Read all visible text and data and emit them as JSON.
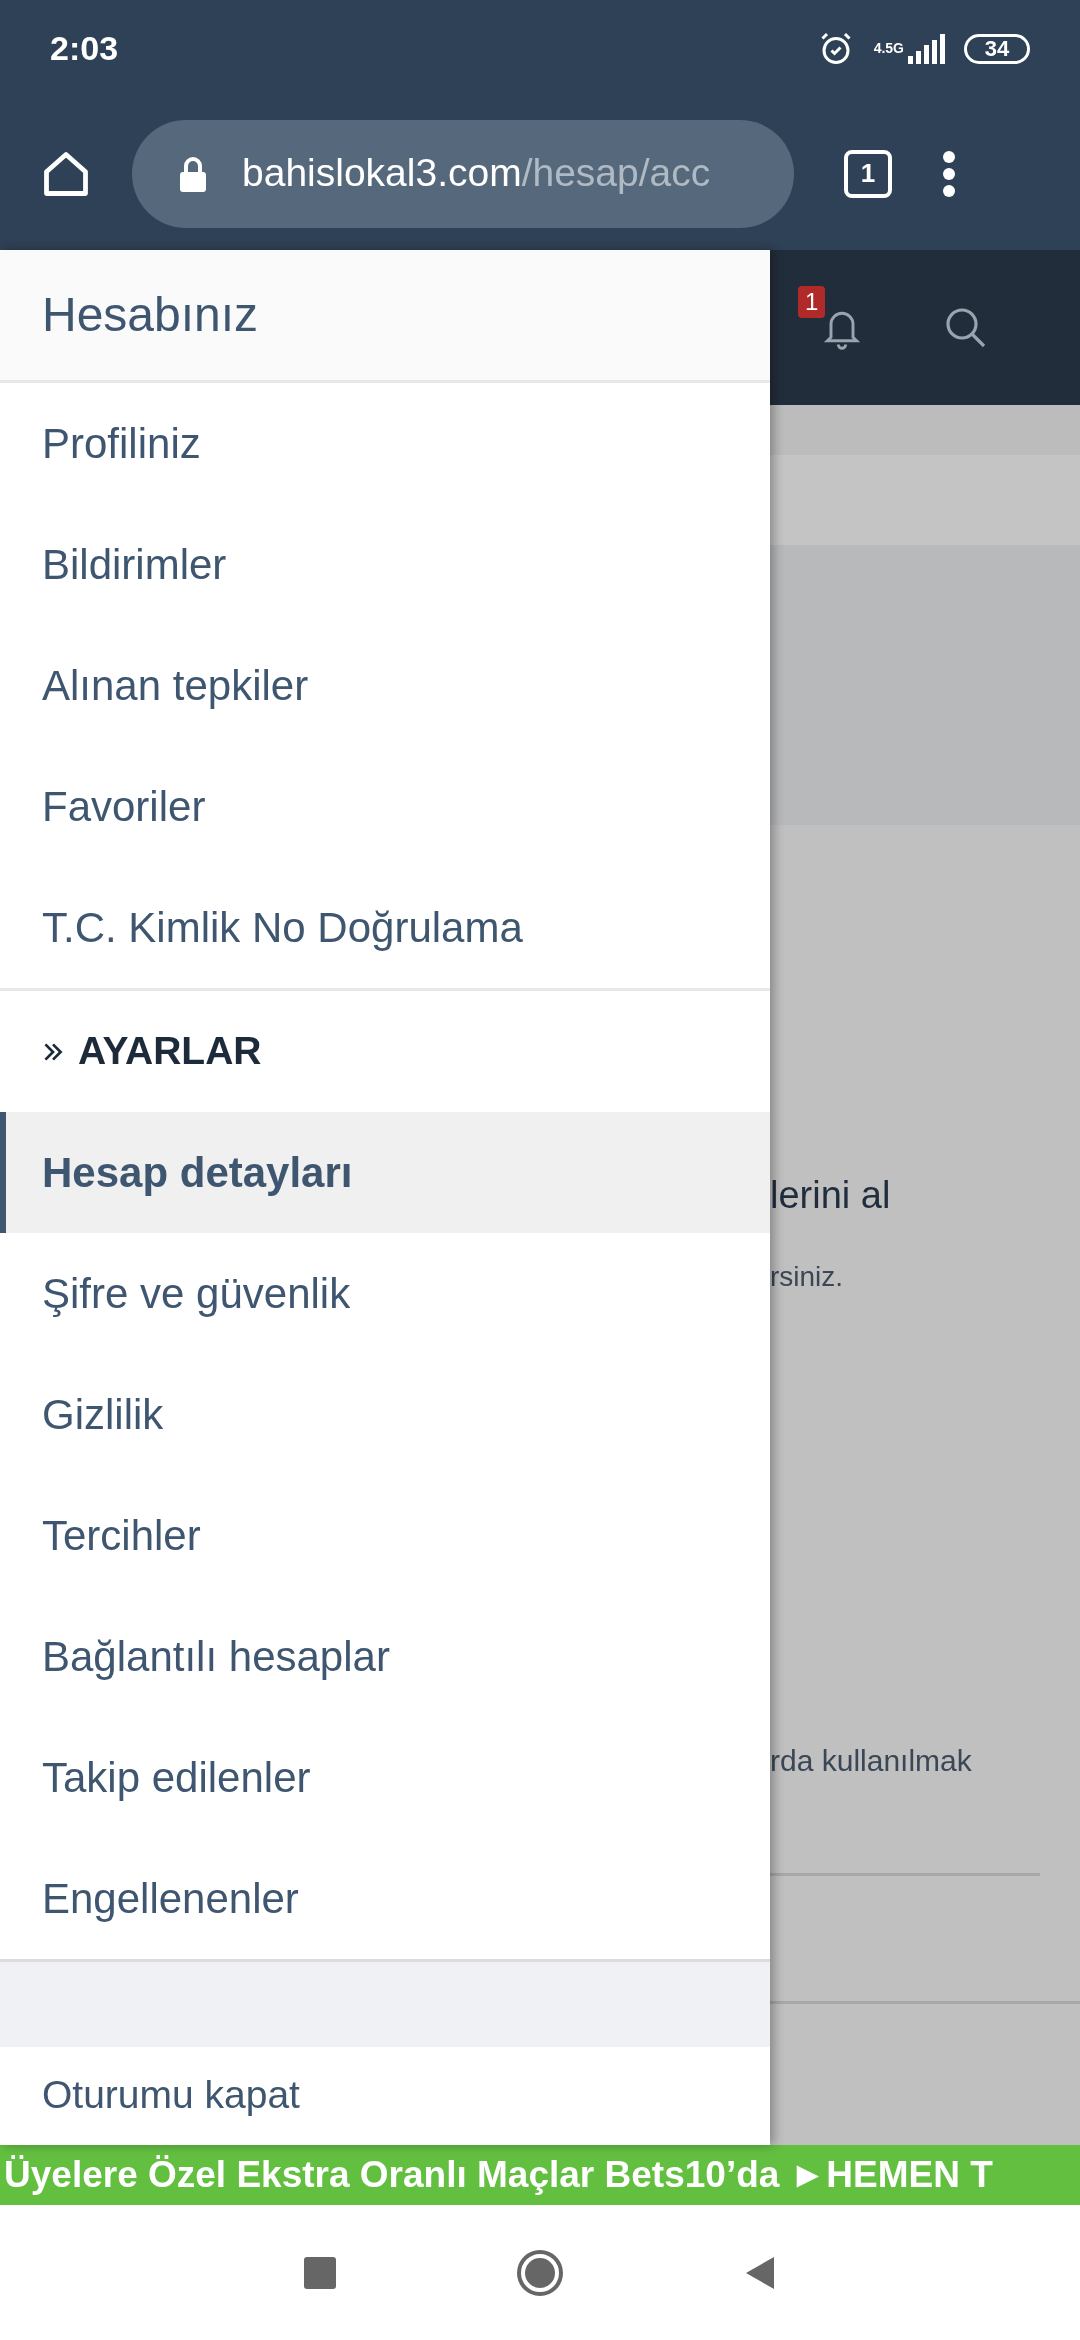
{
  "status_bar": {
    "time": "2:03",
    "network": "4.5G",
    "battery": "34"
  },
  "browser": {
    "url_domain": "bahislokal3.com",
    "url_path": "/hesap/acc",
    "tab_count": "1"
  },
  "page_header": {
    "notification_count": "1"
  },
  "page_behind": {
    "texts": [
      "lerini al",
      "rsiniz.",
      "rda kullanılmak"
    ]
  },
  "drawer": {
    "title": "Hesabınız",
    "groups": [
      {
        "items": [
          {
            "label": "Profiliniz",
            "selected": false
          },
          {
            "label": "Bildirimler",
            "selected": false
          },
          {
            "label": "Alınan tepkiler",
            "selected": false
          },
          {
            "label": "Favoriler",
            "selected": false
          },
          {
            "label": "T.C. Kimlik No Doğrulama",
            "selected": false
          }
        ]
      },
      {
        "heading": "AYARLAR",
        "items": [
          {
            "label": "Hesap detayları",
            "selected": true
          },
          {
            "label": "Şifre ve güvenlik",
            "selected": false
          },
          {
            "label": "Gizlilik",
            "selected": false
          },
          {
            "label": "Tercihler",
            "selected": false
          },
          {
            "label": "Bağlantılı hesaplar",
            "selected": false
          },
          {
            "label": "Takip edilenler",
            "selected": false
          },
          {
            "label": "Engellenenler",
            "selected": false
          }
        ]
      }
    ],
    "footer_items": [
      {
        "label": "Oturumu kapat"
      }
    ]
  },
  "banner": {
    "text": "Üyelere Özel Ekstra Oranlı Maçlar Bets10’da ►HEMEN T"
  }
}
